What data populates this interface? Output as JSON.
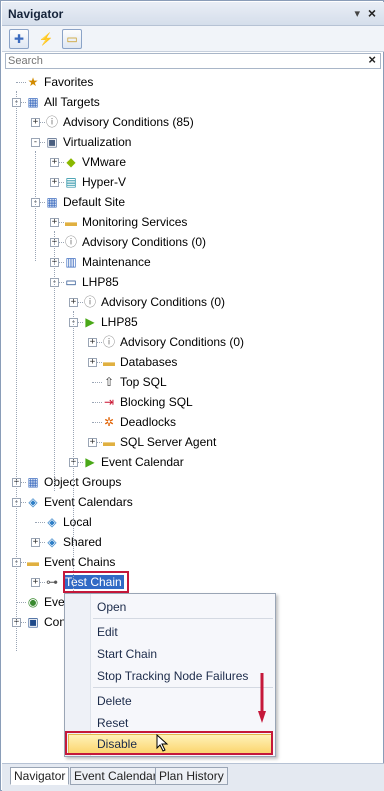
{
  "window": {
    "title": "Navigator",
    "pin_glyph": "▾",
    "close_glyph": "×"
  },
  "toolbar": {
    "buttons": [
      {
        "name": "add-target-icon",
        "glyph": "✚"
      },
      {
        "name": "lightning-icon",
        "glyph": "⚡"
      },
      {
        "name": "folder-add-icon",
        "glyph": "▭"
      }
    ]
  },
  "search": {
    "placeholder": "Search",
    "clear_glyph": "×"
  },
  "tree": [
    {
      "label": "Favorites",
      "icon": "favorites-icon",
      "glyph": "★",
      "color": "#d28b00"
    },
    {
      "label": "All Targets",
      "icon": "all-targets-icon",
      "glyph": "▦",
      "color": "#3b6bbf"
    },
    {
      "label": "Advisory Conditions (85)",
      "icon": "advisory-icon",
      "glyph": "ⓘ",
      "color": "#777777"
    },
    {
      "label": "Virtualization",
      "icon": "virtualization-icon",
      "glyph": "▣",
      "color": "#4a5f80"
    },
    {
      "label": "VMware",
      "icon": "vmware-icon",
      "glyph": "◆",
      "color": "#8ab800"
    },
    {
      "label": "Hyper-V",
      "icon": "hyperv-icon",
      "glyph": "▤",
      "color": "#1a8aa0"
    },
    {
      "label": "Default Site",
      "icon": "site-icon",
      "glyph": "▦",
      "color": "#3b6bbf"
    },
    {
      "label": "Monitoring Services",
      "icon": "folder-gear-icon",
      "glyph": "▬",
      "color": "#e0b040"
    },
    {
      "label": "Advisory Conditions (0)",
      "icon": "advisory-icon",
      "glyph": "ⓘ",
      "color": "#777777"
    },
    {
      "label": "Maintenance",
      "icon": "maintenance-icon",
      "glyph": "▥",
      "color": "#3b6bbf"
    },
    {
      "label": "LHP85",
      "icon": "computer-icon",
      "glyph": "▭",
      "color": "#1f4a8a"
    },
    {
      "label": "Advisory Conditions (0)",
      "icon": "advisory-icon",
      "glyph": "ⓘ",
      "color": "#777777"
    },
    {
      "label": "LHP85",
      "icon": "sql-instance-icon",
      "glyph": "▶",
      "color": "#4aa818"
    },
    {
      "label": "Advisory Conditions (0)",
      "icon": "advisory-icon",
      "glyph": "ⓘ",
      "color": "#777777"
    },
    {
      "label": "Databases",
      "icon": "databases-icon",
      "glyph": "▬",
      "color": "#e0b040"
    },
    {
      "label": "Top SQL",
      "icon": "top-sql-icon",
      "glyph": "⇧",
      "color": "#333333"
    },
    {
      "label": "Blocking SQL",
      "icon": "blocking-sql-icon",
      "glyph": "⇥",
      "color": "#c8102e"
    },
    {
      "label": "Deadlocks",
      "icon": "deadlocks-icon",
      "glyph": "✲",
      "color": "#e06000"
    },
    {
      "label": "SQL Server Agent",
      "icon": "folder-icon",
      "glyph": "▬",
      "color": "#e0b040"
    },
    {
      "label": "Event Calendar",
      "icon": "event-calendar-icon",
      "glyph": "▶",
      "color": "#4aa818"
    },
    {
      "label": "Object Groups",
      "icon": "object-groups-icon",
      "glyph": "▦",
      "color": "#3b6bbf"
    },
    {
      "label": "Event Calendars",
      "icon": "event-calendars-icon",
      "glyph": "◈",
      "color": "#2f7fc7"
    },
    {
      "label": "Local",
      "icon": "calendar-local-icon",
      "glyph": "◈",
      "color": "#2f7fc7"
    },
    {
      "label": "Shared",
      "icon": "calendar-shared-icon",
      "glyph": "◈",
      "color": "#2f7fc7"
    },
    {
      "label": "Event Chains",
      "icon": "event-chains-icon",
      "glyph": "▬",
      "color": "#e0b040"
    },
    {
      "label": "Test Chain",
      "icon": "chain-icon",
      "glyph": "⊶",
      "color": "#555555"
    },
    {
      "label": "Eve",
      "icon": "event-icon",
      "glyph": "◉",
      "color": "#3a8a30"
    },
    {
      "label": "Con",
      "icon": "console-icon",
      "glyph": "▣",
      "color": "#1f4a8a"
    }
  ],
  "context_menu": {
    "items": [
      "Open",
      "Edit",
      "Start Chain",
      "Stop Tracking Node Failures",
      "Delete",
      "Reset",
      "Disable"
    ]
  },
  "annotation_color": "#c5183a",
  "bottom_tabs": [
    "Navigator",
    "Event Calendar",
    "Plan History"
  ]
}
